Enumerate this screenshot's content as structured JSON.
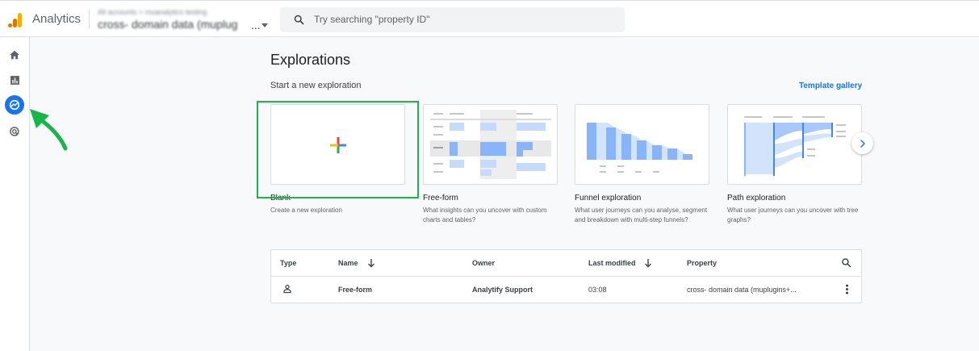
{
  "app": {
    "title": "Analytics",
    "account_path": "All accounts > muanalytics testing",
    "account_name": "cross- domain data (muplug",
    "account_ellipsis": "..."
  },
  "search": {
    "placeholder": "Try searching \"property ID\""
  },
  "page": {
    "heading": "Explorations",
    "subheading": "Start a new exploration",
    "template_link": "Template gallery"
  },
  "templates": [
    {
      "title": "Blank",
      "description": "Create a new exploration"
    },
    {
      "title": "Free-form",
      "description": "What insights can you uncover with custom charts and tables?"
    },
    {
      "title": "Funnel exploration",
      "description": "What user journeys can you analyse, segment and breakdown with multi-step funnels?"
    },
    {
      "title": "Path exploration",
      "description": "What user journeys can you uncover with tree graphs?"
    }
  ],
  "table": {
    "columns": [
      "Type",
      "Name",
      "Owner",
      "Last modified",
      "Property"
    ],
    "rows": [
      {
        "name": "Free-form",
        "owner": "Analytify Support",
        "last_modified": "03:08",
        "property": "cross- domain data (muplugins+..."
      }
    ]
  },
  "colors": {
    "accent": "#1a73e8",
    "highlight": "#19b54a"
  },
  "icons": [
    "analytics-logo-icon",
    "search-icon",
    "home-icon",
    "reports-icon",
    "explore-icon",
    "advertising-icon",
    "arrow-pointer-icon",
    "chevron-right-icon",
    "sort-down-icon",
    "person-icon",
    "more-vert-icon"
  ]
}
